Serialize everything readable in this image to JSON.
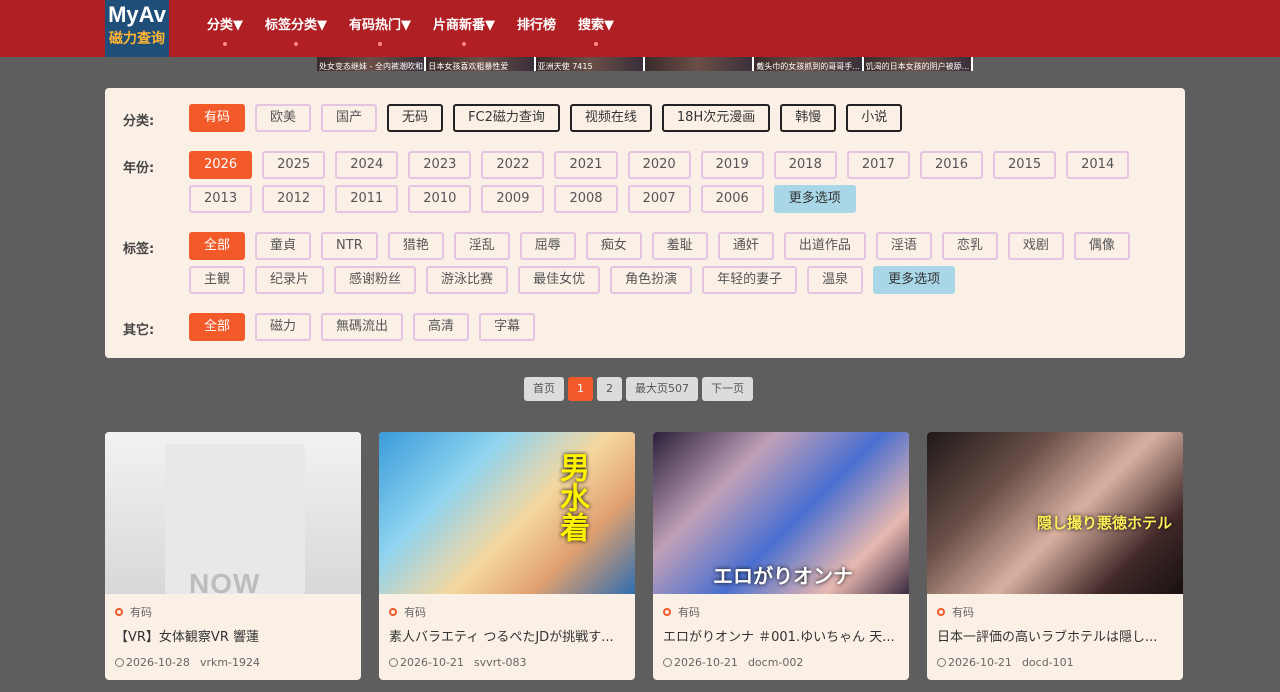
{
  "header": {
    "logo_top": "MyAv",
    "logo_bottom": "磁力查询",
    "nav": [
      {
        "label": "分类▼",
        "dot": true
      },
      {
        "label": "标签分类▼",
        "dot": true
      },
      {
        "label": "有码热门▼",
        "dot": true
      },
      {
        "label": "片商新番▼",
        "dot": true
      },
      {
        "label": "排行榜",
        "dot": false
      },
      {
        "label": "搜索▼",
        "dot": true
      }
    ]
  },
  "banner": [
    "处女变态继妹 - 全内裤潮吹和...",
    "日本女孩喜欢粗暴性爱",
    "亚洲天使 7415",
    "",
    "戴头巾的女孩抓到的哥哥手...",
    "饥渴的日本女孩的阴户被舔..."
  ],
  "filters": {
    "category": {
      "label": "分类:",
      "items": [
        {
          "label": "有码",
          "state": "active"
        },
        {
          "label": "欧美",
          "state": ""
        },
        {
          "label": "国产",
          "state": ""
        },
        {
          "label": "无码",
          "state": "dark"
        },
        {
          "label": "FC2磁力查询",
          "state": "dark"
        },
        {
          "label": "视频在线",
          "state": "dark"
        },
        {
          "label": "18H次元漫画",
          "state": "dark"
        },
        {
          "label": "韩慢",
          "state": "dark"
        },
        {
          "label": "小说",
          "state": "dark"
        }
      ]
    },
    "year": {
      "label": "年份:",
      "items": [
        {
          "label": "2026",
          "state": "active"
        },
        {
          "label": "2025",
          "state": ""
        },
        {
          "label": "2024",
          "state": ""
        },
        {
          "label": "2023",
          "state": ""
        },
        {
          "label": "2022",
          "state": ""
        },
        {
          "label": "2021",
          "state": ""
        },
        {
          "label": "2020",
          "state": ""
        },
        {
          "label": "2019",
          "state": ""
        },
        {
          "label": "2018",
          "state": ""
        },
        {
          "label": "2017",
          "state": ""
        },
        {
          "label": "2016",
          "state": ""
        },
        {
          "label": "2015",
          "state": ""
        },
        {
          "label": "2014",
          "state": ""
        },
        {
          "label": "2013",
          "state": ""
        },
        {
          "label": "2012",
          "state": ""
        },
        {
          "label": "2011",
          "state": ""
        },
        {
          "label": "2010",
          "state": ""
        },
        {
          "label": "2009",
          "state": ""
        },
        {
          "label": "2008",
          "state": ""
        },
        {
          "label": "2007",
          "state": ""
        },
        {
          "label": "2006",
          "state": ""
        },
        {
          "label": "更多选项",
          "state": "more"
        }
      ]
    },
    "tags": {
      "label": "标签:",
      "items": [
        {
          "label": "全部",
          "state": "active"
        },
        {
          "label": "童貞",
          "state": ""
        },
        {
          "label": "NTR",
          "state": ""
        },
        {
          "label": "猎艳",
          "state": ""
        },
        {
          "label": "淫乱",
          "state": ""
        },
        {
          "label": "屈辱",
          "state": ""
        },
        {
          "label": "痴女",
          "state": ""
        },
        {
          "label": "羞耻",
          "state": ""
        },
        {
          "label": "通奸",
          "state": ""
        },
        {
          "label": "出道作品",
          "state": ""
        },
        {
          "label": "淫语",
          "state": ""
        },
        {
          "label": "恋乳",
          "state": ""
        },
        {
          "label": "戏剧",
          "state": ""
        },
        {
          "label": "偶像",
          "state": ""
        },
        {
          "label": "主観",
          "state": ""
        },
        {
          "label": "纪录片",
          "state": ""
        },
        {
          "label": "感谢粉丝",
          "state": ""
        },
        {
          "label": "游泳比赛",
          "state": ""
        },
        {
          "label": "最佳女优",
          "state": ""
        },
        {
          "label": "角色扮演",
          "state": ""
        },
        {
          "label": "年轻的妻子",
          "state": ""
        },
        {
          "label": "温泉",
          "state": ""
        },
        {
          "label": "更多选项",
          "state": "more"
        }
      ]
    },
    "other": {
      "label": "其它:",
      "items": [
        {
          "label": "全部",
          "state": "active"
        },
        {
          "label": "磁力",
          "state": ""
        },
        {
          "label": "無碼流出",
          "state": ""
        },
        {
          "label": "高清",
          "state": ""
        },
        {
          "label": "字幕",
          "state": ""
        }
      ]
    }
  },
  "pagination": [
    {
      "label": "首页",
      "active": false
    },
    {
      "label": "1",
      "active": true
    },
    {
      "label": "2",
      "active": false
    },
    {
      "label": "最大页507",
      "active": false
    },
    {
      "label": "下一页",
      "active": false
    }
  ],
  "cards": [
    {
      "category": "有码",
      "title": "【VR】女体観察VR 響蓮",
      "date": "2026-10-28",
      "code": "vrkm-1924",
      "thumb_text": "NOW"
    },
    {
      "category": "有码",
      "title": "素人バラエティ つるぺたJDが挑戦す...",
      "date": "2026-10-21",
      "code": "svvrt-083",
      "thumb_text": "男水着"
    },
    {
      "category": "有码",
      "title": "エロがりオンナ ＃001.ゆいちゃん 天...",
      "date": "2026-10-21",
      "code": "docm-002",
      "thumb_text": "エロがりオンナ"
    },
    {
      "category": "有码",
      "title": "日本一評価の高いラブホテルは隠し...",
      "date": "2026-10-21",
      "code": "docd-101",
      "thumb_text": "隠し撮り悪徳ホテル"
    }
  ]
}
